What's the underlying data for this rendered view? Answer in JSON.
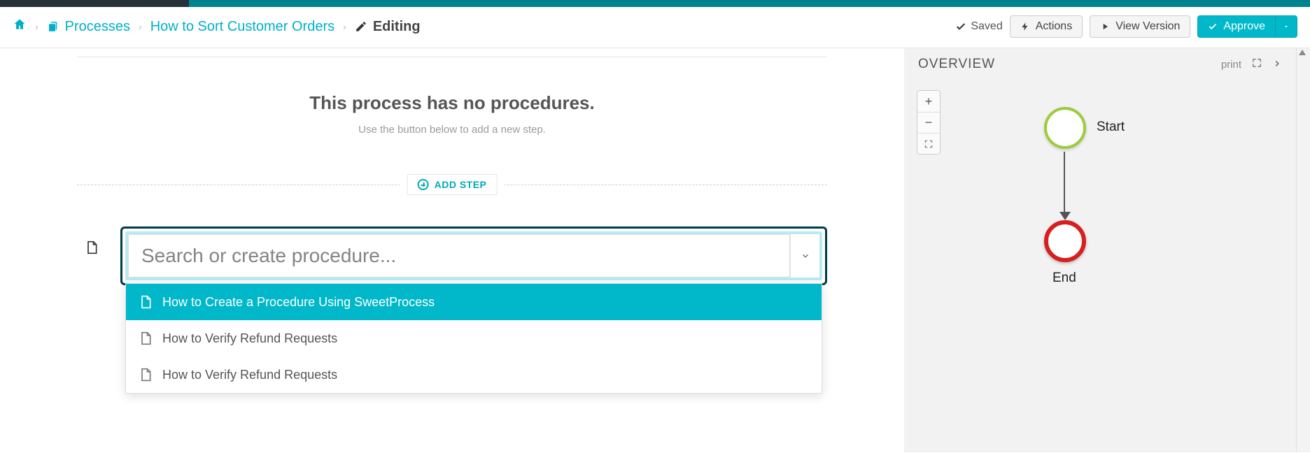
{
  "breadcrumb": {
    "processes": "Processes",
    "process_title": "How to Sort Customer Orders",
    "editing": "Editing"
  },
  "header": {
    "saved": "Saved",
    "actions": "Actions",
    "view_version": "View Version",
    "approve": "Approve"
  },
  "main": {
    "empty_title": "This process has no procedures.",
    "empty_sub": "Use the button below to add a new step.",
    "add_step": "ADD STEP",
    "search_placeholder": "Search or create procedure...",
    "options": [
      {
        "label": "How to Create a Procedure Using SweetProcess",
        "active": true
      },
      {
        "label": "How to Verify Refund Requests",
        "active": false
      },
      {
        "label": "How to Verify Refund Requests",
        "active": false
      }
    ]
  },
  "overview": {
    "title": "OVERVIEW",
    "print": "print",
    "start": "Start",
    "end": "End"
  },
  "colors": {
    "teal": "#00b8c9",
    "teal_border": "#00a3b3",
    "start_node": "#9ccc3c",
    "end_node": "#d81f1f"
  }
}
